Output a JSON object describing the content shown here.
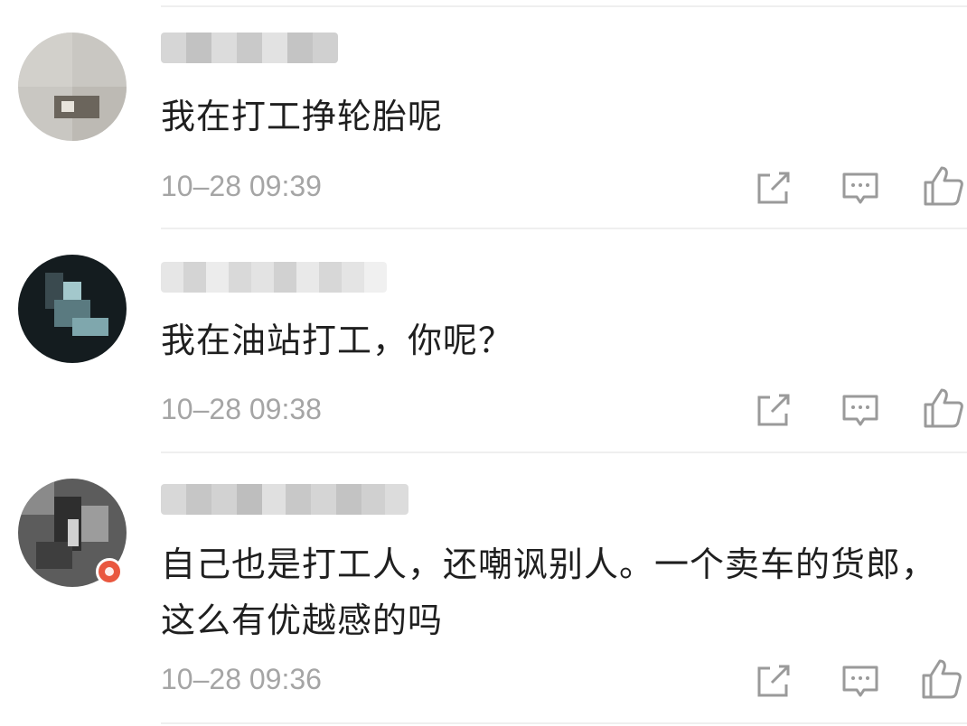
{
  "comments": [
    {
      "text": "我在打工挣轮胎呢",
      "time": "10–28 09:39",
      "avatar_icon": "user-avatar-blurred"
    },
    {
      "text": "我在油站打工，你呢？",
      "time": "10–28 09:38",
      "avatar_icon": "user-avatar-blurred"
    },
    {
      "text": "自己也是打工人，还嘲讽别人。一个卖车的货郎，这么有优越感的吗",
      "time": "10–28 09:36",
      "avatar_icon": "user-avatar-blurred",
      "has_badge": true
    }
  ],
  "actions": {
    "share_icon": "share-icon",
    "reply_icon": "comment-icon",
    "like_icon": "thumbs-up-icon"
  },
  "colors": {
    "time": "#a5a5a5",
    "text": "#1f1f1f",
    "icon": "#9a9a9a",
    "badge": "#e9573f"
  }
}
